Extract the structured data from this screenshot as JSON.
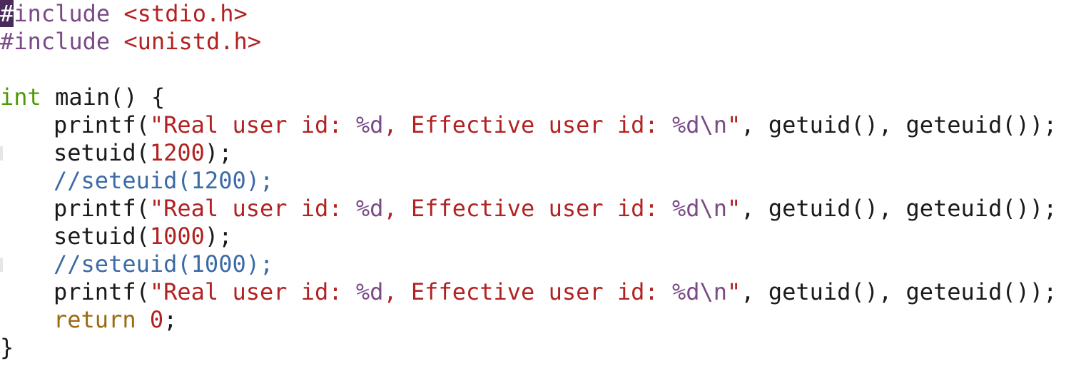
{
  "code": {
    "line1": {
      "first_char": "#",
      "directive": "include",
      "header": "<stdio.h>"
    },
    "line2": {
      "directive": "#include",
      "header": "<unistd.h>"
    },
    "line4": {
      "type": "int",
      "signature": " main() {"
    },
    "printf_line": {
      "fn": "printf(",
      "str_a": "\"Real user id: ",
      "fmt_a": "%d",
      "str_b": ", Effective user id: ",
      "fmt_b": "%d\\n",
      "str_c": "\"",
      "rest": ", getuid(), geteuid());"
    },
    "setuid1": {
      "fn": "setuid(",
      "arg": "1200",
      "end": ");"
    },
    "comment1": "//seteuid(1200);",
    "setuid2": {
      "fn": "setuid(",
      "arg": "1000",
      "end": ");"
    },
    "comment2": "//seteuid(1000);",
    "return_line": {
      "kw": "return",
      "space": " ",
      "num": "0",
      "end": ";"
    },
    "closing": "}"
  }
}
